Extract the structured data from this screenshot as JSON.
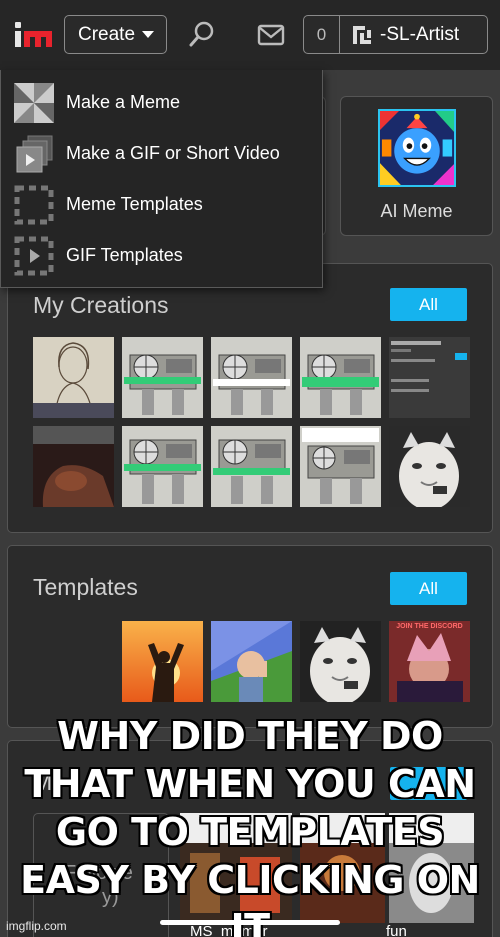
{
  "header": {
    "logo": "imgflip logo",
    "create_label": "Create",
    "notification_count": "0",
    "username": "-SL-Artist"
  },
  "dropdown": {
    "items": [
      {
        "label": "Make a Meme",
        "icon": "pinwheel-icon"
      },
      {
        "label": "Make a GIF or Short Video",
        "icon": "video-stack-icon"
      },
      {
        "label": "Meme Templates",
        "icon": "dashed-square-icon"
      },
      {
        "label": "GIF Templates",
        "icon": "dashed-play-icon"
      }
    ]
  },
  "tiles": {
    "ai_meme_label": "AI Meme"
  },
  "my_creations": {
    "title": "My Creations",
    "all_label": "All",
    "thumb_texts": [
      "",
      "",
      "",
      "",
      "",
      "",
      "",
      "",
      "",
      ""
    ]
  },
  "templates": {
    "title": "Templates",
    "all_label": "All",
    "thumb_texts": [
      "",
      "",
      "",
      "JOIN THE DISCORD"
    ]
  },
  "bottom_section": {
    "title_fragment": "M",
    "title_fragment2": "e",
    "left_card_text": "Followe",
    "left_card_text2": "y)",
    "labels": [
      "MS_memer",
      "fun"
    ]
  },
  "overlay": {
    "caption": "WHY DID THEY DO THAT WHEN YOU CAN GO TO TEMPLATES EASY BY CLICKING ON IT",
    "watermark": "imgflip.com"
  }
}
